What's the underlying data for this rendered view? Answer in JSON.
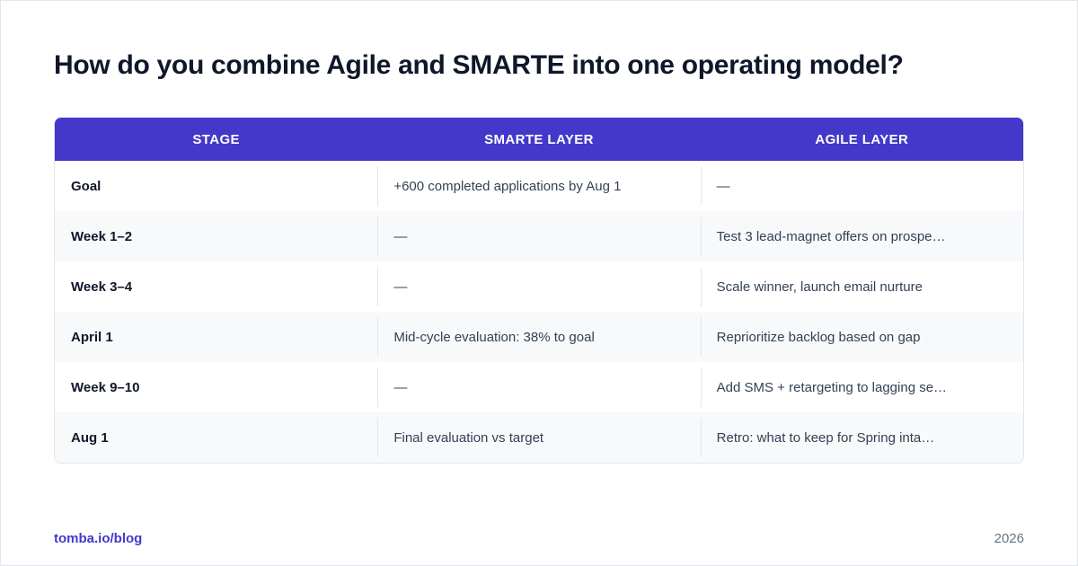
{
  "title": "How do you combine Agile and SMARTE into one operating model?",
  "table": {
    "headers": [
      "STAGE",
      "SMARTE LAYER",
      "AGILE LAYER"
    ],
    "rows": [
      [
        "Goal",
        "+600 completed applications by Aug 1",
        "—"
      ],
      [
        "Week 1–2",
        "—",
        "Test 3 lead-magnet offers on prospe…"
      ],
      [
        "Week 3–4",
        "—",
        "Scale winner, launch email nurture"
      ],
      [
        "April 1",
        "Mid-cycle evaluation: 38% to goal",
        "Reprioritize backlog based on gap"
      ],
      [
        "Week 9–10",
        "—",
        "Add SMS + retargeting to lagging se…"
      ],
      [
        "Aug 1",
        "Final evaluation vs target",
        "Retro: what to keep for Spring inta…"
      ]
    ]
  },
  "footer": {
    "source": "tomba.io/blog",
    "year": "2026"
  },
  "colors": {
    "header_bg": "#4338ca",
    "accent": "#4338ca",
    "title": "#0f172a",
    "row_alt": "#f8f9fb"
  }
}
